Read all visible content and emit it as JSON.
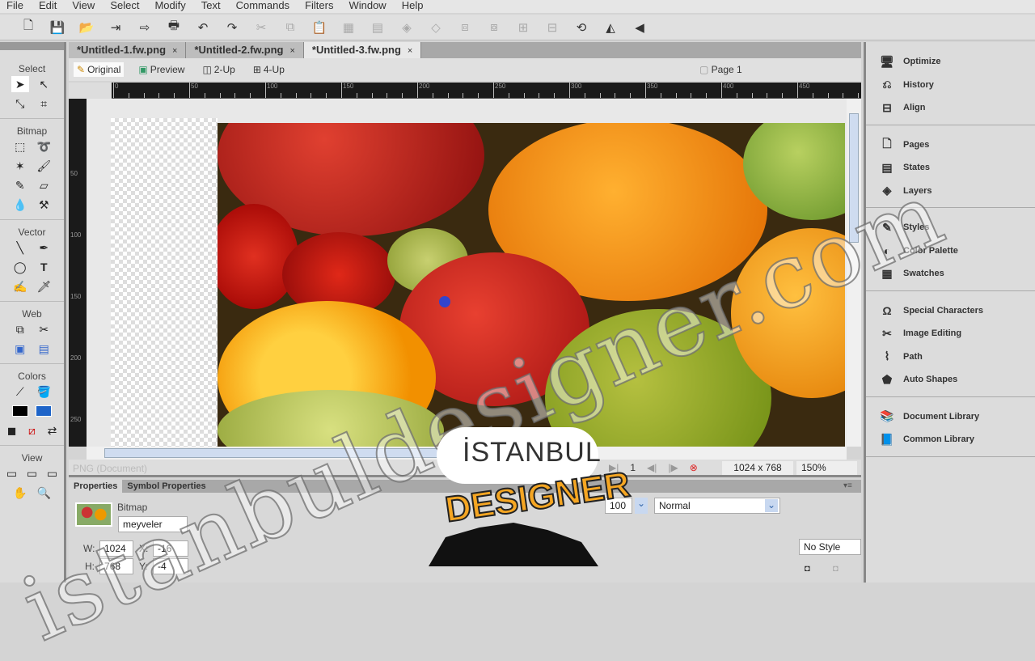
{
  "menu": [
    "File",
    "Edit",
    "View",
    "Select",
    "Modify",
    "Text",
    "Commands",
    "Filters",
    "Window",
    "Help"
  ],
  "toolbar_icons": [
    "new-icon",
    "save-icon",
    "open-icon",
    "import-icon",
    "export-icon",
    "print-icon",
    "undo-icon",
    "redo-icon",
    "cut-icon",
    "copy-icon",
    "paste-icon",
    "group-icon",
    "ungroup-icon",
    "join-icon",
    "split-icon",
    "bring-front-icon",
    "send-back-icon",
    "align-icon",
    "distribute-icon",
    "rotate-icon",
    "flip-h-icon",
    "flip-v-icon"
  ],
  "tools": {
    "select": "Select",
    "bitmap": "Bitmap",
    "vector": "Vector",
    "web": "Web",
    "colors": "Colors",
    "view": "View",
    "stroke_color": "#000000",
    "fill_color": "#1e64c8"
  },
  "tabs": [
    {
      "label": "*Untitled-1.fw.png",
      "active": false
    },
    {
      "label": "*Untitled-2.fw.png",
      "active": false
    },
    {
      "label": "*Untitled-3.fw.png",
      "active": true
    }
  ],
  "close_glyph": "×",
  "view_modes": [
    "Original",
    "Preview",
    "2-Up",
    "4-Up"
  ],
  "page_label": "Page 1",
  "ruler_h": [
    "0",
    "50",
    "100",
    "150",
    "200",
    "250",
    "300",
    "350",
    "400",
    "450"
  ],
  "ruler_v": [
    "50",
    "100",
    "150",
    "200",
    "250"
  ],
  "status": {
    "doc_type": "PNG (Document)",
    "frame": "1",
    "size": "1024 x 768",
    "zoom": "150%"
  },
  "properties": {
    "tab": "Properties",
    "tab2": "Symbol Properties",
    "type": "Bitmap",
    "name": "meyveler",
    "w_label": "W:",
    "w": "1024",
    "h_label": "H:",
    "h": "768",
    "x_label": "X:",
    "x": "-16",
    "y_label": "Y:",
    "y": "-4",
    "opacity": "100",
    "blend": "Normal",
    "style": "No Style"
  },
  "right_panel": [
    [
      "Optimize",
      "History",
      "Align"
    ],
    [
      "Pages",
      "States",
      "Layers"
    ],
    [
      "Styles",
      "Color Palette",
      "Swatches"
    ],
    [
      "Special Characters",
      "Image Editing",
      "Path",
      "Auto Shapes"
    ],
    [
      "Document Library",
      "Common Library"
    ]
  ],
  "watermark": "istanbuldesigner.com",
  "logo": {
    "line1": "İSTANBUL",
    "line2": "DESIGNER"
  }
}
